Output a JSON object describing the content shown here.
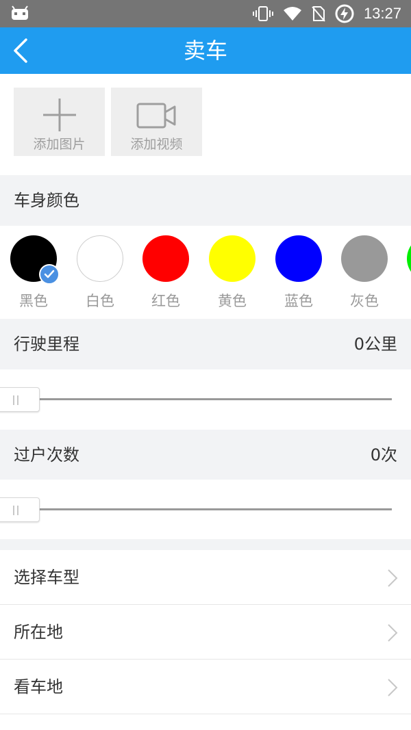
{
  "status_bar": {
    "time": "13:27",
    "icons": [
      "android-icon",
      "vibrate-icon",
      "wifi-icon",
      "no-sim-icon",
      "battery-charging-icon"
    ]
  },
  "app_bar": {
    "title": "卖车",
    "back_icon": "chevron-left-icon"
  },
  "media": {
    "add_photo_label": "添加图片",
    "add_video_label": "添加视频"
  },
  "color_section": {
    "title": "车身颜色",
    "selected": "黑色",
    "swatches": [
      {
        "label": "黑色",
        "color": "#000000"
      },
      {
        "label": "白色",
        "color": "#ffffff"
      },
      {
        "label": "红色",
        "color": "#ff0000"
      },
      {
        "label": "黄色",
        "color": "#ffff00"
      },
      {
        "label": "蓝色",
        "color": "#0000ff"
      },
      {
        "label": "灰色",
        "color": "#999999"
      },
      {
        "label": "",
        "color": "#00ee00"
      }
    ]
  },
  "mileage": {
    "title": "行驶里程",
    "value": "0公里",
    "slider_fraction": 0
  },
  "transfers": {
    "title": "过户次数",
    "value": "0次",
    "slider_fraction": 0
  },
  "list": {
    "items": [
      "选择车型",
      "所在地",
      "看车地"
    ]
  },
  "colors": {
    "appbar": "#1f9cf0",
    "statusbar": "#757575",
    "section_bg": "#f2f3f5",
    "check": "#4a90e2"
  }
}
